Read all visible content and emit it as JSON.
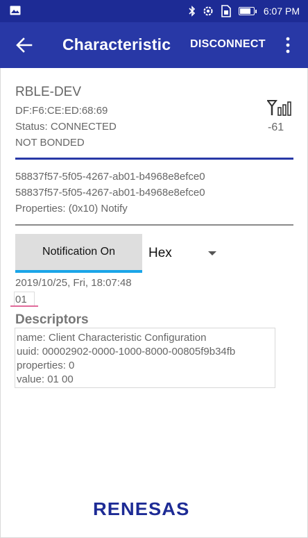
{
  "status_bar": {
    "time": "6:07 PM",
    "icons": [
      "image-icon",
      "bluetooth-icon",
      "settings-sync-icon",
      "sim-icon",
      "battery-icon"
    ],
    "battery_level": 0.8
  },
  "app_bar": {
    "title": "Characteristic",
    "disconnect_label": "DISCONNECT"
  },
  "device": {
    "name": "RBLE-DEV",
    "address": "DF:F6:CE:ED:68:69",
    "status": "Status:  CONNECTED",
    "bond": "NOT BONDED",
    "rssi": "-61"
  },
  "characteristic": {
    "service_uuid": "58837f57-5f05-4267-ab01-b4968e8efce0",
    "char_uuid": "58837f57-5f05-4267-ab01-b4968e8efce0",
    "properties": "Properties: (0x10) Notify"
  },
  "controls": {
    "notification_label": "Notification On",
    "format_selected": "Hex"
  },
  "reading": {
    "timestamp": "2019/10/25, Fri, 18:07:48",
    "value": "01"
  },
  "descriptors": {
    "heading": "Descriptors",
    "lines": [
      "name: Client Characteristic Configuration",
      "uuid: 00002902-0000-1000-8000-00805f9b34fb",
      "properties: 0",
      "value: 01 00"
    ]
  },
  "footer": {
    "logo_text": "RENESAS"
  },
  "colors": {
    "status_bar": "#1d2b95",
    "app_bar": "#2838a6",
    "accent": "#1aa5e8",
    "highlight": "#e06a9a"
  }
}
